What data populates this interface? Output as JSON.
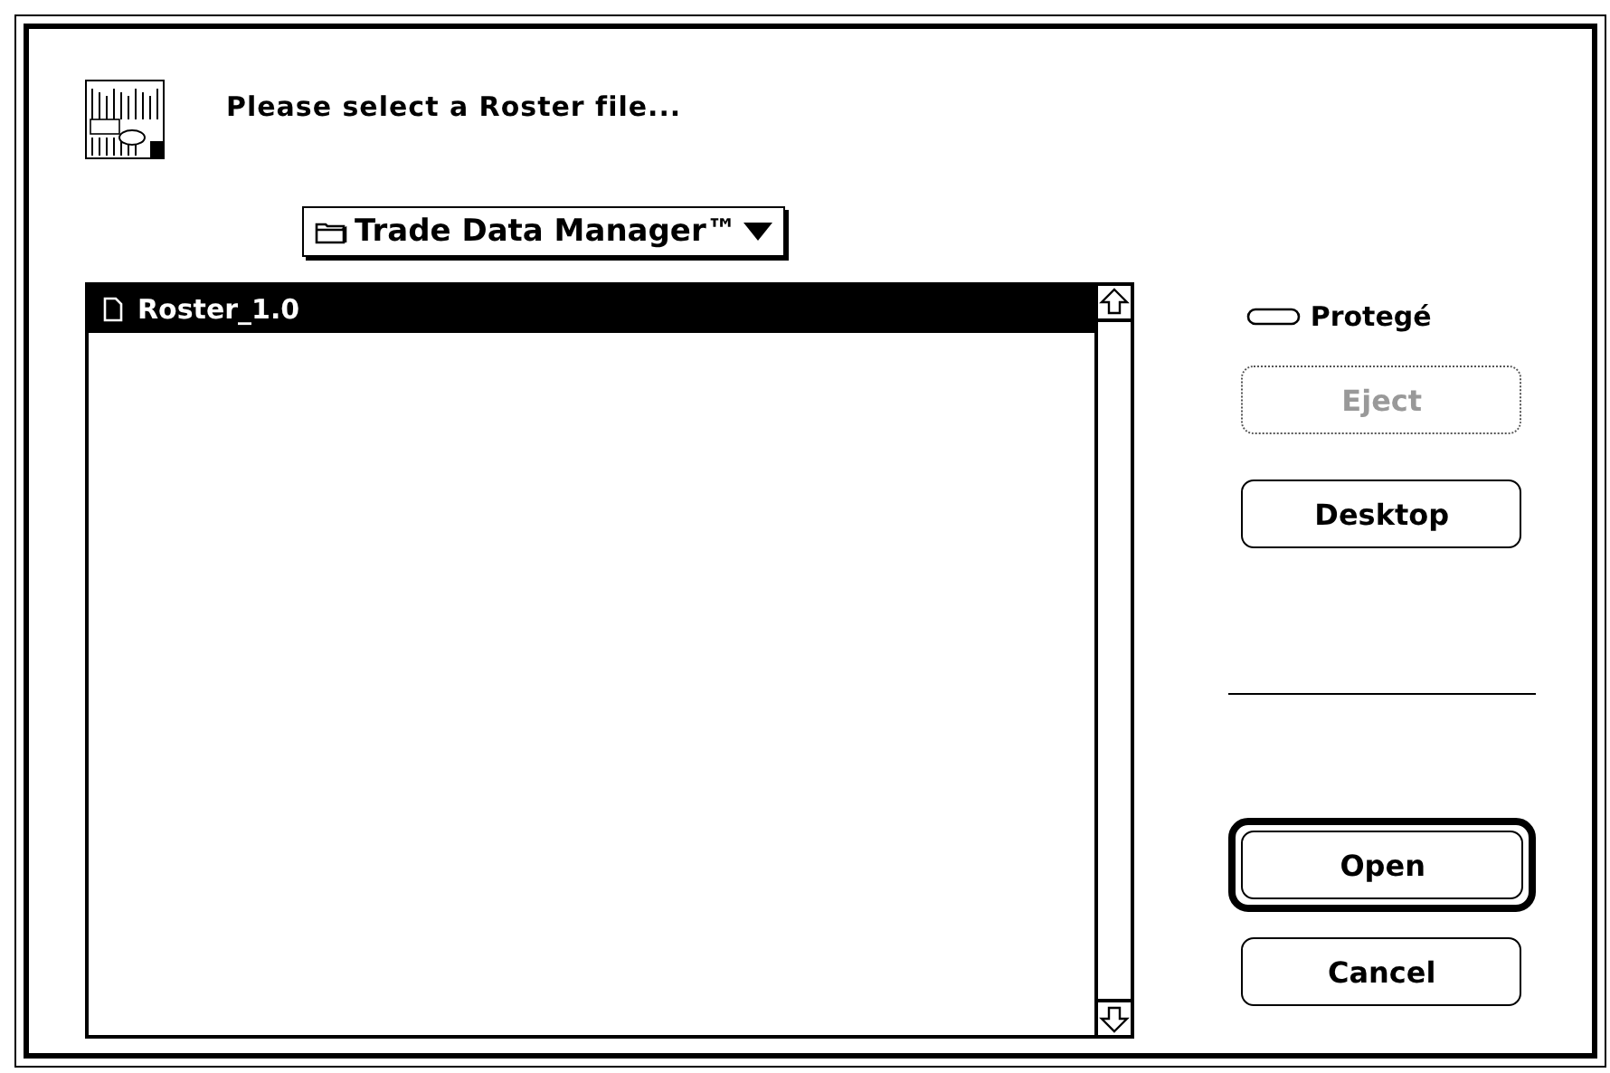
{
  "prompt": "Please select a Roster file...",
  "folder_popup": {
    "label": "Trade Data Manager™"
  },
  "files": [
    {
      "name": "Roster_1.0",
      "selected": true
    }
  ],
  "volume": {
    "name": "Protegé"
  },
  "buttons": [
    {
      "label": "Eject",
      "disabled": true,
      "default": false
    },
    {
      "label": "Desktop",
      "disabled": false,
      "default": false
    },
    {
      "label": "Open",
      "disabled": false,
      "default": true
    },
    {
      "label": "Cancel",
      "disabled": false,
      "default": false
    }
  ]
}
